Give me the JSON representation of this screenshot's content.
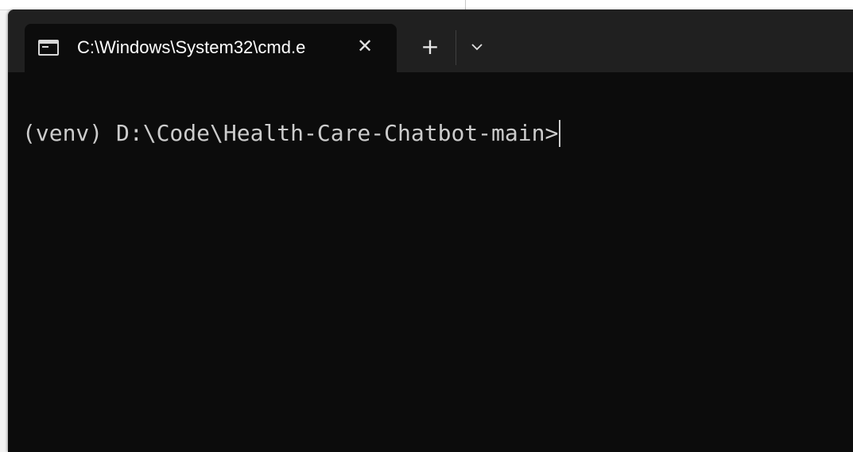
{
  "tab": {
    "title": "C:\\Windows\\System32\\cmd.e",
    "close_glyph": "✕"
  },
  "toolbar": {
    "new_tab_glyph": "+",
    "dropdown_icon": "chevron-down-icon"
  },
  "terminal": {
    "prompt": "(venv) D:\\Code\\Health-Care-Chatbot-main>"
  },
  "colors": {
    "terminal_background": "#0c0c0c",
    "titlebar_background": "#202020",
    "terminal_text": "#cccccc"
  }
}
